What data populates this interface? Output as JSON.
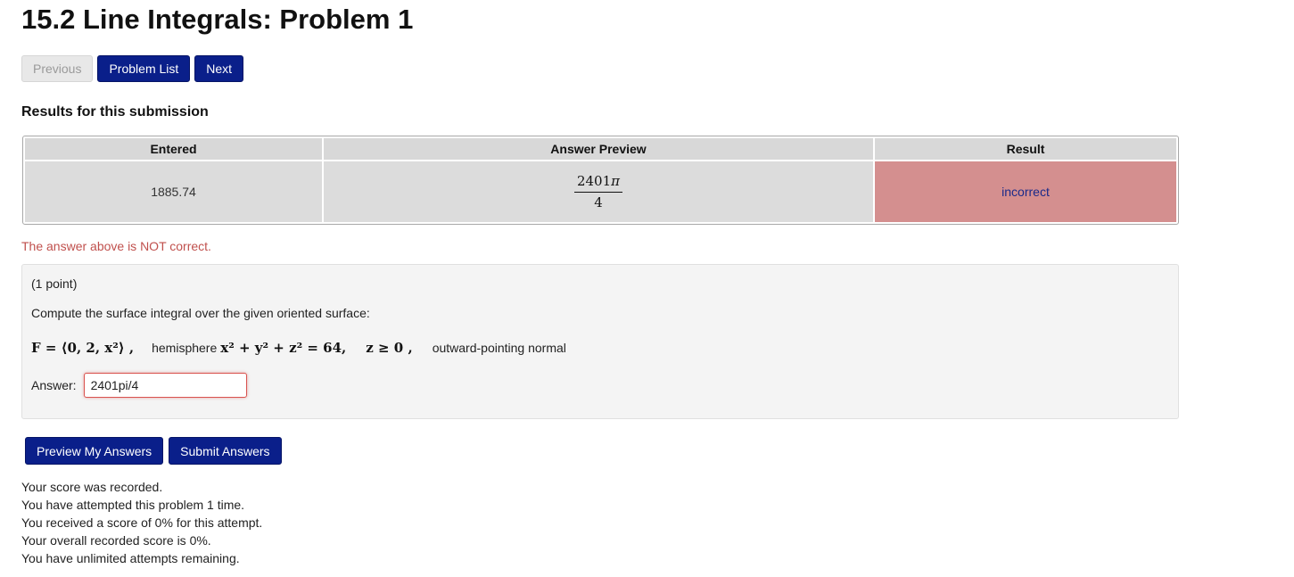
{
  "page_title": "15.2 Line Integrals: Problem 1",
  "nav": {
    "previous": "Previous",
    "problem_list": "Problem List",
    "next": "Next"
  },
  "results": {
    "heading": "Results for this submission",
    "columns": [
      "Entered",
      "Answer Preview",
      "Result"
    ],
    "row": {
      "entered": "1885.74",
      "preview_numerator": "2401",
      "preview_pi": "π",
      "preview_denominator": "4",
      "result": "incorrect"
    },
    "message": "The answer above is NOT correct."
  },
  "problem": {
    "points": "(1 point)",
    "prompt": "Compute the surface integral over the given oriented surface:",
    "field_math": "F = ⟨0, 2, x²⟩ ,",
    "surface_label": "hemisphere",
    "surface_math": "x² + y² + z² = 64,",
    "condition_math": "z ≥ 0 ,",
    "orientation": "outward-pointing normal",
    "answer_label": "Answer:",
    "answer_value": "2401pi/4"
  },
  "actions": {
    "preview": "Preview My Answers",
    "submit": "Submit Answers"
  },
  "status_lines": [
    "Your score was recorded.",
    "You have attempted this problem 1 time.",
    "You received a score of 0% for this attempt.",
    "Your overall recorded score is 0%.",
    "You have unlimited attempts remaining."
  ],
  "colors": {
    "primary_button": "#0a1f8a",
    "incorrect_cell": "#d48f8f",
    "error_text": "#c0504d"
  }
}
